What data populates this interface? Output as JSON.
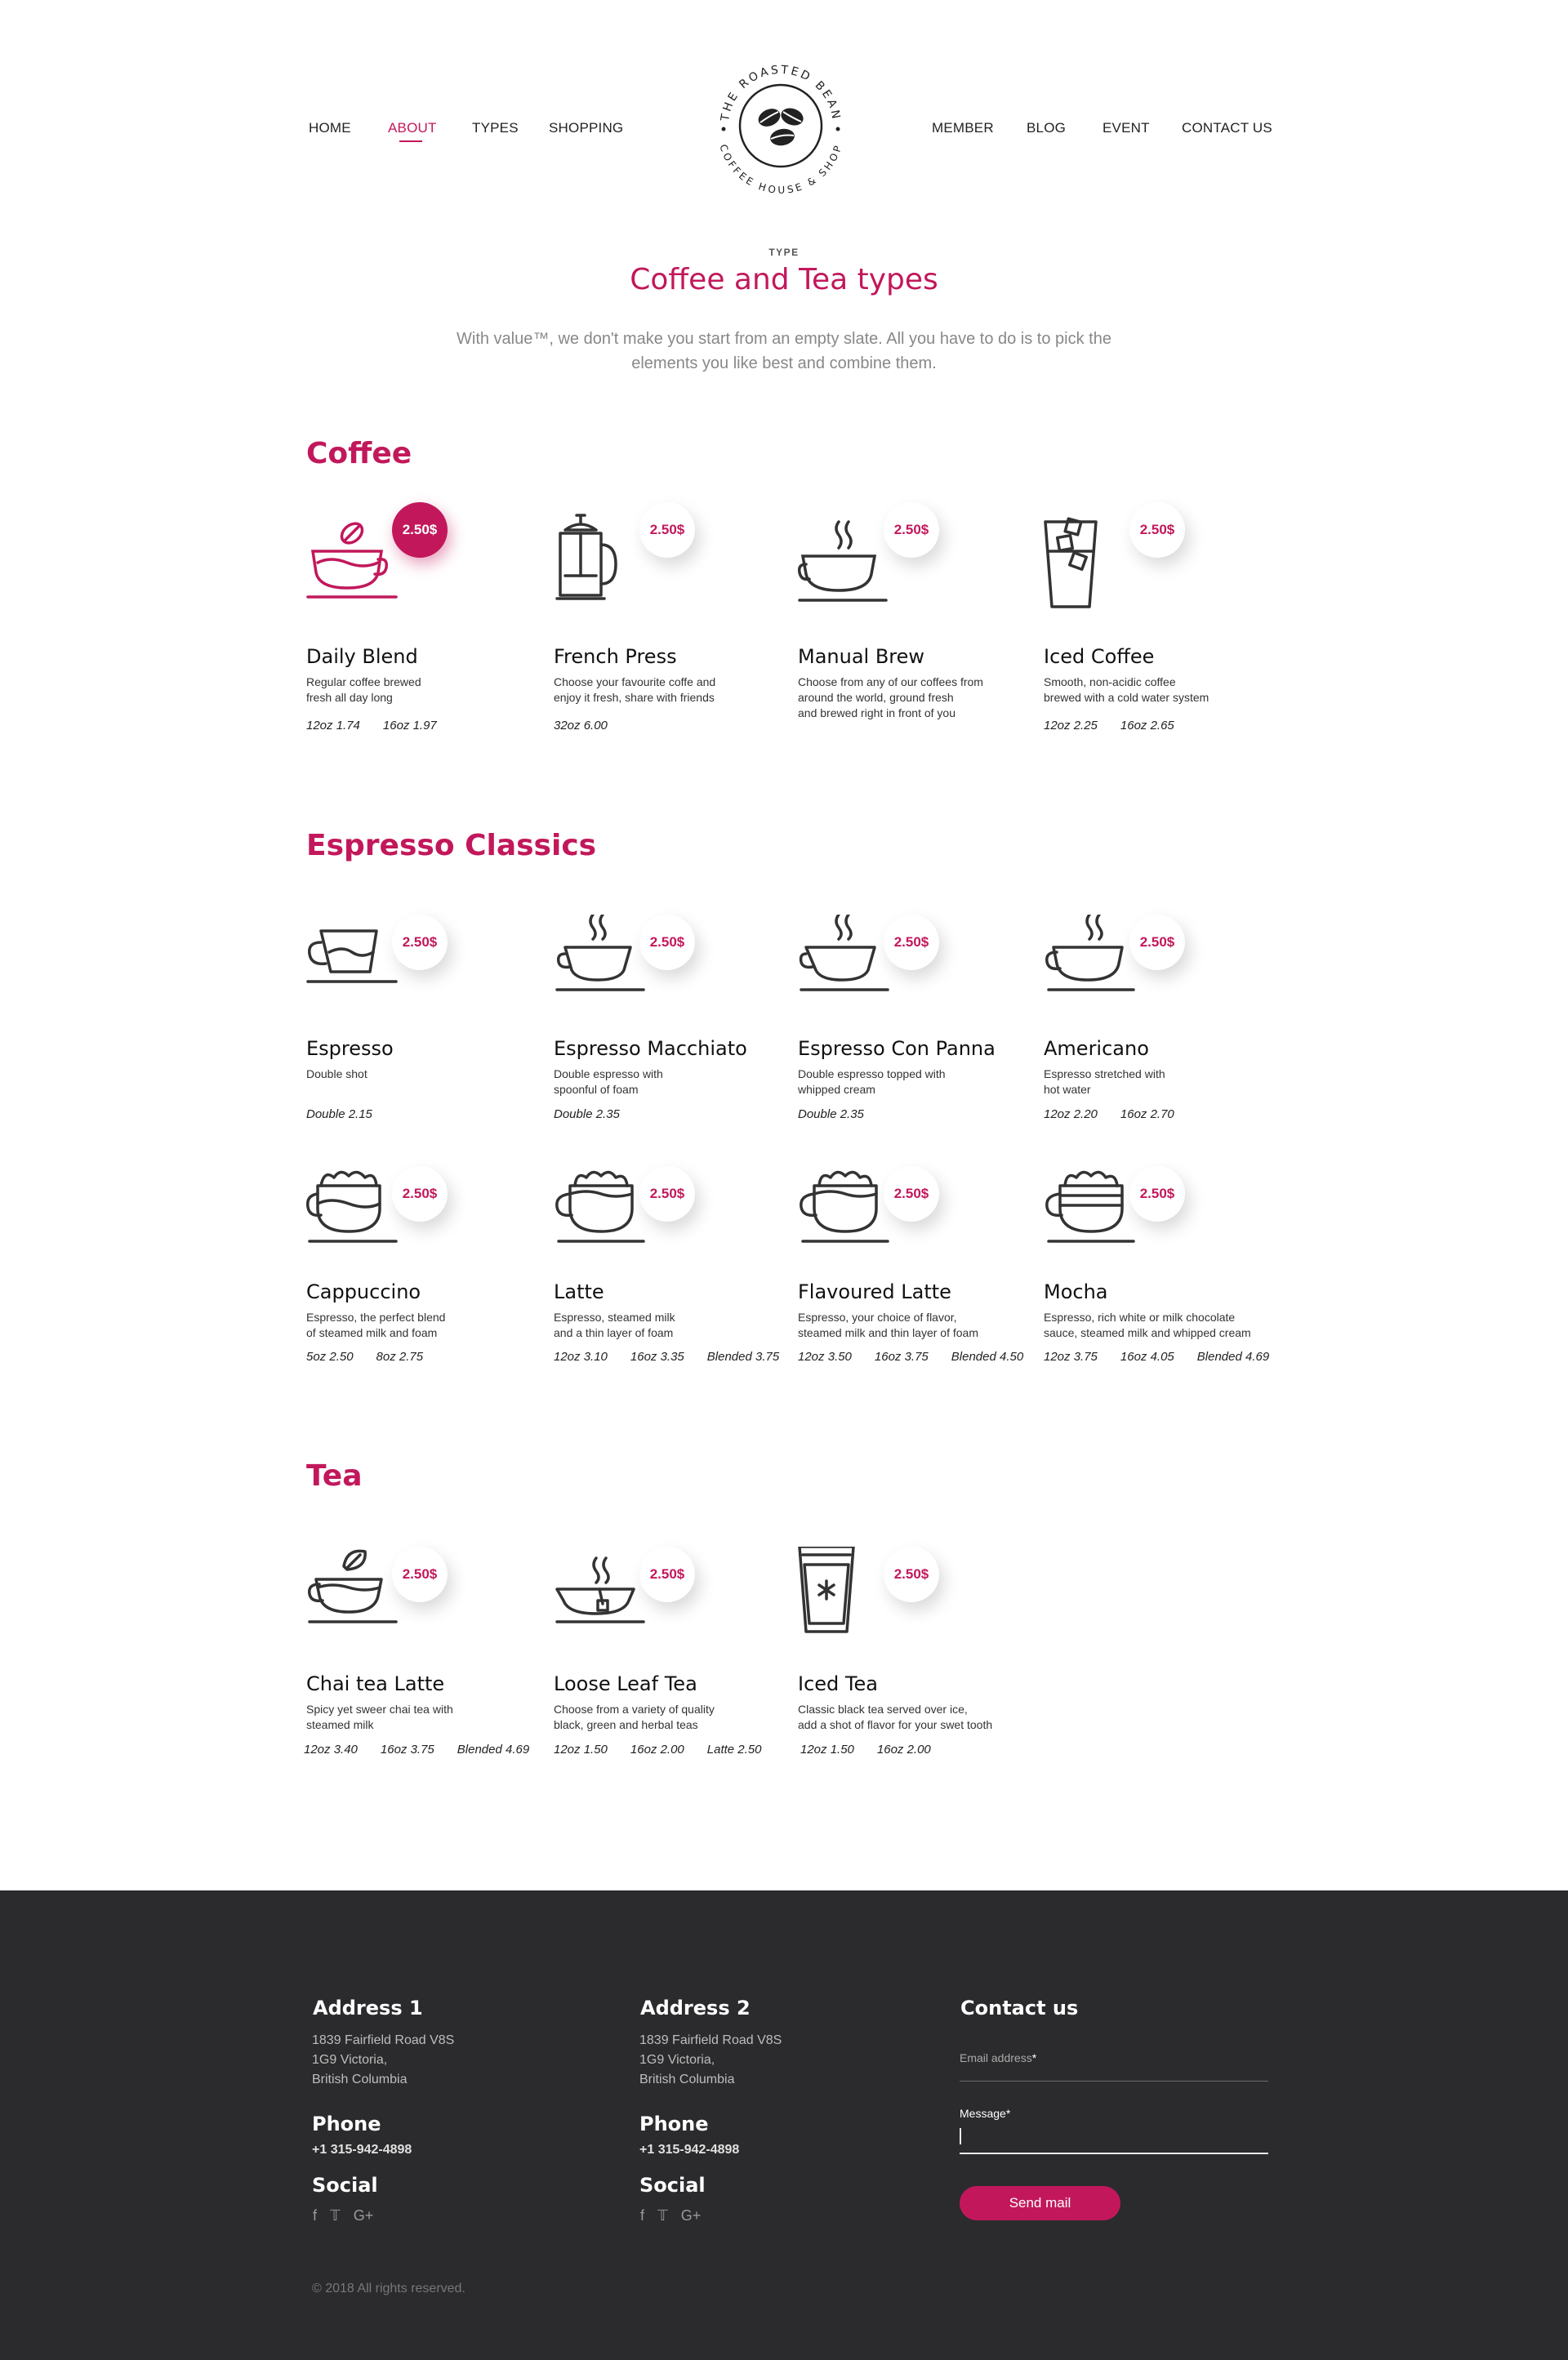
{
  "nav": {
    "left": [
      "HOME",
      "ABOUT",
      "TYPES",
      "SHOPPING"
    ],
    "right": [
      "MEMBER",
      "BLOG",
      "EVENT",
      "CONTACT US"
    ],
    "active": "ABOUT"
  },
  "logo": {
    "top_text": "THE ROASTED BEAN",
    "bottom_text": "COFFEE HOUSE & SHOP"
  },
  "hero": {
    "tag": "TYPE",
    "title": "Coffee and Tea types",
    "desc_line1": "With value™, we don't make you start from an empty slate. All you have to do is to pick the",
    "desc_line2": "elements you like best and combine them."
  },
  "sections": {
    "coffee": "Coffee",
    "espresso": "Espresso Classics",
    "tea": "Tea"
  },
  "items": [
    {
      "name": "Daily Blend",
      "price": "2.50$",
      "icon": "coffee-bean-cup-icon",
      "desc1": "Regular coffee brewed",
      "desc2": "fresh all day long",
      "sizes": [
        "12oz 1.74",
        "16oz 1.97"
      ]
    },
    {
      "name": "French Press",
      "price": "2.50$",
      "icon": "french-press-icon",
      "desc1": "Choose your favourite coffe and",
      "desc2": "enjoy it fresh, share with friends",
      "sizes": [
        "32oz   6.00"
      ]
    },
    {
      "name": "Manual Brew",
      "price": "2.50$",
      "icon": "steaming-mug-icon",
      "desc1": "Choose from any of our coffees from",
      "desc2": "around the world, ground fresh",
      "desc3": "and brewed right in front of you",
      "sizes": []
    },
    {
      "name": "Iced Coffee",
      "price": "2.50$",
      "icon": "iced-glass-icon",
      "desc1": "Smooth, non-acidic coffee",
      "desc2": "brewed with a cold water system",
      "sizes": [
        "12oz 2.25",
        "16oz 2.65"
      ]
    },
    {
      "name": "Espresso",
      "price": "2.50$",
      "icon": "espresso-cup-icon",
      "desc1": "Double shot",
      "desc2": "",
      "sizes": [
        "Double 2.15"
      ]
    },
    {
      "name": "Espresso Macchiato",
      "price": "2.50$",
      "icon": "steaming-cup-icon",
      "desc1": "Double espresso with",
      "desc2": "spoonful of foam",
      "sizes": [
        "Double 2.35"
      ]
    },
    {
      "name": "Espresso Con Panna",
      "price": "2.50$",
      "icon": "steaming-cup-icon",
      "desc1": "Double espresso topped with",
      "desc2": "whipped cream",
      "sizes": [
        "Double 2.35"
      ]
    },
    {
      "name": "Americano",
      "price": "2.50$",
      "icon": "steaming-mug-icon",
      "desc1": "Espresso stretched with",
      "desc2": "hot water",
      "sizes": [
        "12oz 2.20",
        "16oz 2.70"
      ]
    },
    {
      "name": "Cappuccino",
      "price": "2.50$",
      "icon": "foam-cup-icon",
      "desc1": "Espresso, the perfect blend",
      "desc2": "of steamed milk and foam",
      "sizes": [
        "5oz 2.50",
        "8oz 2.75"
      ]
    },
    {
      "name": "Latte",
      "price": "2.50$",
      "icon": "foam-cup-icon",
      "desc1": "Espresso, steamed milk",
      "desc2": "and a thin layer of foam",
      "sizes": [
        "12oz 3.10",
        "16oz 3.35",
        "Blended 3.75"
      ]
    },
    {
      "name": "Flavoured Latte",
      "price": "2.50$",
      "icon": "foam-cup-icon",
      "desc1": "Espresso, your choice of flavor,",
      "desc2": "steamed milk and thin layer of foam",
      "sizes": [
        "12oz 3.50",
        "16oz 3.75",
        "Blended 4.50"
      ]
    },
    {
      "name": "Mocha",
      "price": "2.50$",
      "icon": "layered-cup-icon",
      "desc1": "Espresso, rich white or milk chocolate",
      "desc2": "sauce, steamed milk and whipped cream",
      "sizes": [
        "12oz 3.75",
        "16oz 4.05",
        "Blended 4.69"
      ]
    },
    {
      "name": "Chai tea Latte",
      "price": "2.50$",
      "icon": "leaf-cup-icon",
      "desc1": "Spicy yet sweer chai tea with",
      "desc2": "steamed milk",
      "sizes": [
        "12oz 3.40",
        "16oz 3.75",
        "Blended 4.69"
      ]
    },
    {
      "name": "Loose Leaf Tea",
      "price": "2.50$",
      "icon": "teabag-cup-icon",
      "desc1": "Choose from a variety of quality",
      "desc2": "black, green and herbal teas",
      "sizes": [
        "12oz 1.50",
        "16oz 2.00",
        "Latte 2.50"
      ]
    },
    {
      "name": "Iced Tea",
      "price": "2.50$",
      "icon": "iced-tea-glass-icon",
      "desc1": "Classic black tea served over ice,",
      "desc2": "add a shot of flavor for your swet tooth",
      "sizes": [
        "12oz 1.50",
        "16oz 2.00"
      ]
    }
  ],
  "footer": {
    "address1_title": "Address 1",
    "address1_lines": [
      "1839 Fairfield Road V8S",
      "1G9 Victoria,",
      "British Columbia"
    ],
    "address2_title": "Address 2",
    "address2_lines": [
      "1839 Fairfield Road V8S",
      "1G9 Victoria,",
      "British Columbia"
    ],
    "phone_title": "Phone",
    "phone": "+1 315-942-4898",
    "social_title": "Social",
    "social_icons": [
      "facebook-icon",
      "twitter-icon",
      "google-plus-icon"
    ],
    "contact_title": "Contact us",
    "email_label": "Email address",
    "message_label": "Message",
    "required_mark": "*",
    "send_label": "Send mail",
    "copyright": "© 2018 All rights reserved."
  },
  "colors": {
    "accent": "#c2185b",
    "footer_bg": "#2b2b2d",
    "icon_stroke": "#333333"
  }
}
